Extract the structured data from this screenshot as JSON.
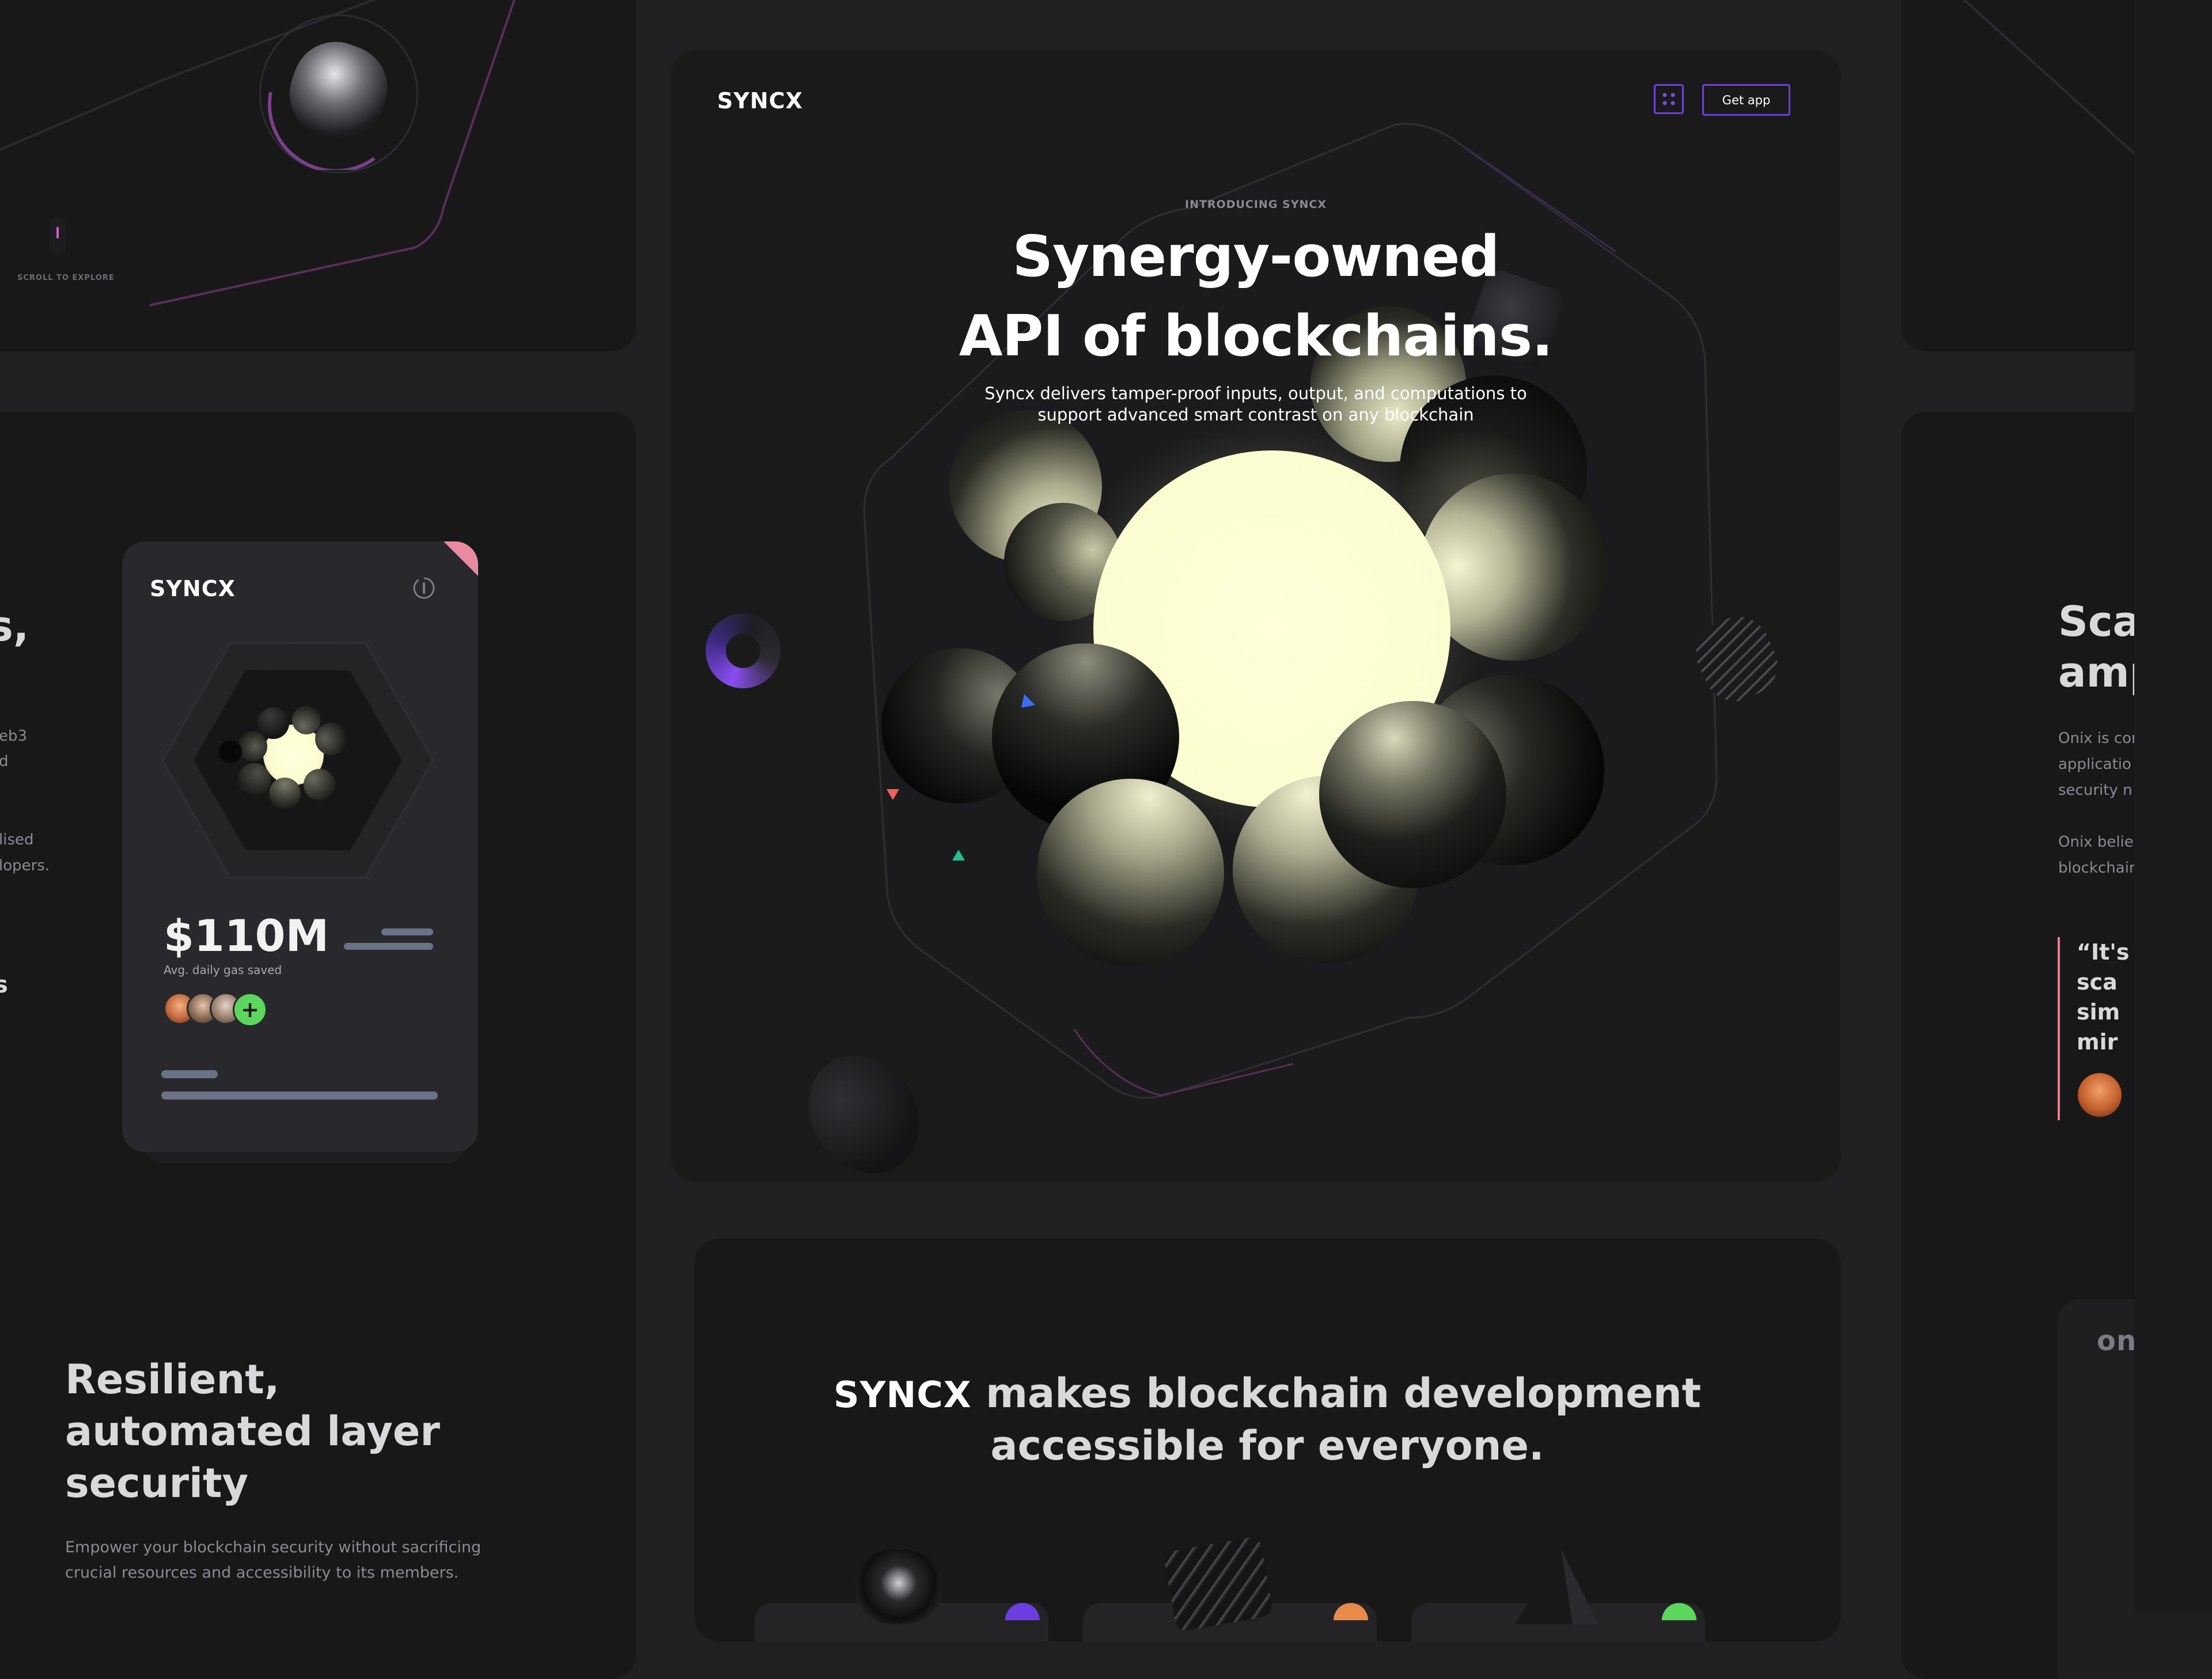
{
  "brand": "SYNCX",
  "top_left": {
    "scroll_label": "SCROLL TO EXPLORE"
  },
  "hero": {
    "get_app": "Get app",
    "eyebrow": "INTRODUCING SYNCX",
    "title_line1": "Synergy-owned",
    "title_line2": "API of blockchains.",
    "subtitle_line1": "Syncx delivers tamper-proof inputs, output, and computations to",
    "subtitle_line2": "support advanced smart contrast on any blockchain"
  },
  "left_partial": {
    "heading_fragment": "s,",
    "line1": "eb3",
    "line2": "d",
    "line3": "lised",
    "line4": "lopers.",
    "fragment": "s"
  },
  "card": {
    "stat_value": "$110M",
    "stat_label": "Avg. daily gas saved",
    "add_symbol": "+"
  },
  "security": {
    "title_line1": "Resilient,",
    "title_line2": "automated layer",
    "title_line3": "security",
    "body_line1": "Empower your blockchain security without sacrificing",
    "body_line2": "crucial resources and accessibility to its members."
  },
  "bottom_center": {
    "brand_inline": "SYNCX",
    "line1_rest": "makes blockchain development",
    "line2": "accessible for everyone."
  },
  "right_partial": {
    "title_line1": "Sca",
    "title_line2": "amp",
    "p1_line1": "Onix is cor",
    "p1_line2": "applicatio",
    "p1_line3": "security n",
    "p2_line1": "Onix belie",
    "p2_line2": "blockchair",
    "quote_line1": "“It's",
    "quote_line2": "sca",
    "quote_line3": "sim",
    "quote_line4": "mir",
    "card_fragment": "on"
  },
  "colors": {
    "background": "#202023",
    "panel": "#181819",
    "accent_purple": "#7b3ff2",
    "glow_yellow": "#feffd2",
    "accent_pink": "#f07a8f",
    "accent_green": "#5cd65c"
  },
  "icons": {
    "menu": "grid-menu-icon",
    "sync": "sync-icon",
    "add": "plus-icon"
  }
}
